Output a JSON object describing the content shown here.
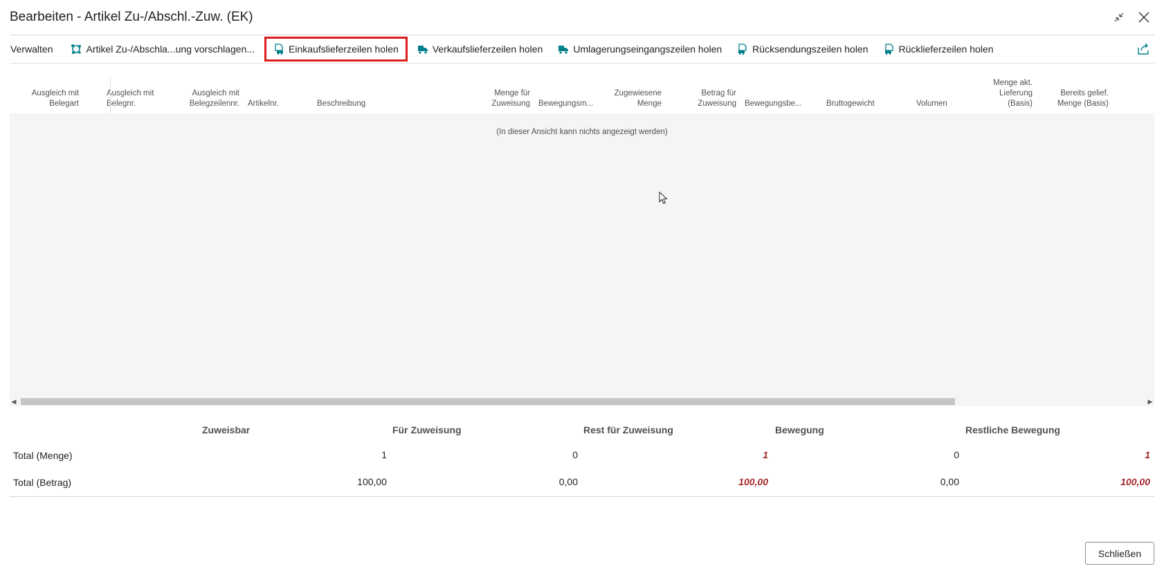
{
  "window": {
    "title": "Bearbeiten - Artikel Zu-/Abschl.-Zuw. (EK)"
  },
  "actions": {
    "manage": "Verwalten",
    "suggest": "Artikel Zu-/Abschla...ung vorschlagen...",
    "purchase_receipts": "Einkaufslieferzeilen holen",
    "sales_shipments": "Verkaufslieferzeilen holen",
    "transfer_receipts": "Umlagerungseingangszeilen holen",
    "return_receipts": "Rücksendungszeilen holen",
    "return_shipments": "Rücklieferzeilen holen"
  },
  "columns": {
    "c1": "Ausgleich mit Belegart",
    "c2": "Ausgleich mit Belegnr.",
    "c3": "Ausgleich mit Belegzeilennr.",
    "c4": "Artikelnr.",
    "c5": "Beschreibung",
    "c6": "Menge für Zuweisung",
    "c7": "Bewegungsm...",
    "c8": "Zugewiesene Menge",
    "c9": "Betrag für Zuweisung",
    "c10": "Bewegungsbe...",
    "c11": "Bruttogewicht",
    "c12": "Volumen",
    "c13": "Menge akt. Lieferung (Basis)",
    "c14": "Bereits gelief. Menge (Basis)"
  },
  "grid": {
    "empty_message": "(In dieser Ansicht kann nichts angezeigt werden)"
  },
  "totals": {
    "headers": {
      "assignable": "Zuweisbar",
      "to_assign": "Für Zuweisung",
      "rem_to_assign": "Rest für Zuweisung",
      "movement": "Bewegung",
      "rem_movement": "Restliche Bewegung"
    },
    "rows": {
      "qty": {
        "label": "Total (Menge)",
        "assignable": "1",
        "to_assign": "0",
        "rem_to_assign": "1",
        "movement": "0",
        "rem_movement": "1"
      },
      "amount": {
        "label": "Total (Betrag)",
        "assignable": "100,00",
        "to_assign": "0,00",
        "rem_to_assign": "100,00",
        "movement": "0,00",
        "rem_movement": "100,00"
      }
    }
  },
  "footer": {
    "close_label": "Schließen"
  },
  "icons": {
    "collapse": "collapse-icon",
    "close": "close-icon",
    "share": "share-icon",
    "suggest": "suggest-icon",
    "document": "document-truck-icon",
    "truck": "truck-icon"
  },
  "colors": {
    "accent_icon": "#00808a",
    "highlight_outline": "#e01b1b",
    "warning_text": "#a4262c"
  }
}
